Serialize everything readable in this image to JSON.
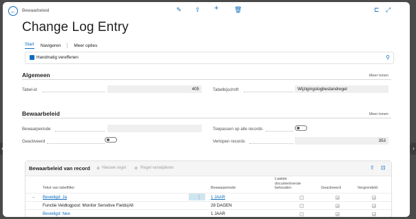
{
  "header": {
    "breadcrumb": "Bewaarbeleid",
    "title": "Change Log Entry"
  },
  "tabs": [
    "Start",
    "Navigeren",
    "Meer opties"
  ],
  "actionbar": {
    "action_label": "Handmatig vereffenen"
  },
  "general": {
    "title": "Algemeen",
    "more_label": "Meer tonen",
    "table_id_label": "Tabel-id",
    "table_id_value": "405",
    "table_caption_label": "Tabelbijschrift",
    "table_caption_value": "Wijzigingslogbestandregel"
  },
  "policy": {
    "title": "Bewaarbeleid",
    "more_label": "Meer tonen",
    "period_label": "Bewaarperiode",
    "period_value": "",
    "activated_label": "Geactiveerd",
    "activated_value": false,
    "apply_all_label": "Toepassen op alle records",
    "apply_all_value": false,
    "expired_label": "Verlopen records",
    "expired_value": "353"
  },
  "record_policy": {
    "title": "Bewaarbeleid van record",
    "new_line_label": "Nieuwe regel",
    "delete_line_label": "Regel verwijderen",
    "columns": {
      "filter": "Tekst van tabelfilter",
      "period": "Bewaarperiode",
      "keep_last": "Laatste documentversie behouden",
      "activated": "Geactiveerd",
      "locked": "Vergrendeld"
    },
    "rows": [
      {
        "filter": "Beveiligd: Ja",
        "period": "1 JAAR",
        "keep_last": false,
        "activated": true,
        "locked": true
      },
      {
        "filter": "Functie Veldlogpost: Monitor Sensitive Fields|All",
        "period": "28 DAGEN",
        "keep_last": false,
        "activated": true,
        "locked": true
      },
      {
        "filter": "Beveiligd: Nee",
        "period": "1 JAAR",
        "keep_last": false,
        "activated": true,
        "locked": true
      }
    ]
  },
  "colors": {
    "accent": "#0f6cbd",
    "field_bg": "#efefef"
  }
}
